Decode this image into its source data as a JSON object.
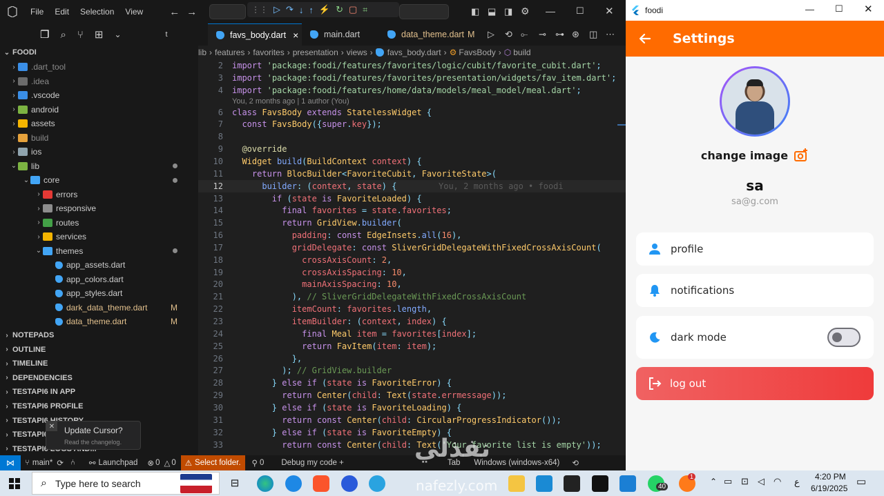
{
  "vscode": {
    "menu": [
      "File",
      "Edit",
      "Selection",
      "View"
    ],
    "sidebar_title": "FOODI",
    "tree": [
      {
        "label": "dart_tool",
        "display": ".dart_tool",
        "depth": 0,
        "expanded": false,
        "color": "#3a8ee6",
        "dim": true
      },
      {
        "label": "idea",
        "display": ".idea",
        "depth": 0,
        "expanded": false,
        "color": "#6b6b6b",
        "dim": true
      },
      {
        "label": "vscode",
        "display": ".vscode",
        "depth": 0,
        "expanded": false,
        "color": "#3a8ee6",
        "dim": false
      },
      {
        "label": "android",
        "display": "android",
        "depth": 0,
        "expanded": false,
        "color": "#7cb342",
        "dim": false
      },
      {
        "label": "assets",
        "display": "assets",
        "depth": 0,
        "expanded": false,
        "color": "#f4b400",
        "dim": false
      },
      {
        "label": "build",
        "display": "build",
        "depth": 0,
        "expanded": false,
        "color": "#e6a23c",
        "dim": true
      },
      {
        "label": "ios",
        "display": "ios",
        "depth": 0,
        "expanded": false,
        "color": "#90a4ae",
        "dim": false
      },
      {
        "label": "lib",
        "display": "lib",
        "depth": 0,
        "expanded": true,
        "color": "#7cb342",
        "dim": false,
        "dot": true
      },
      {
        "label": "core",
        "display": "core",
        "depth": 1,
        "expanded": true,
        "color": "#42a5f5",
        "dim": false,
        "dot": true
      },
      {
        "label": "errors",
        "display": "errors",
        "depth": 2,
        "expanded": false,
        "color": "#e53935",
        "dim": false
      },
      {
        "label": "responsive",
        "display": "responsive",
        "depth": 2,
        "expanded": false,
        "color": "#8d8d8d",
        "dim": false
      },
      {
        "label": "routes",
        "display": "routes",
        "depth": 2,
        "expanded": false,
        "color": "#43a047",
        "dim": false
      },
      {
        "label": "services",
        "display": "services",
        "depth": 2,
        "expanded": false,
        "color": "#f4b400",
        "dim": false
      },
      {
        "label": "themes",
        "display": "themes",
        "depth": 2,
        "expanded": true,
        "color": "#42a5f5",
        "dim": false,
        "dot": true
      },
      {
        "label": "app_assets",
        "display": "app_assets.dart",
        "depth": 3,
        "file": true,
        "color": "#42a5f5"
      },
      {
        "label": "app_colors",
        "display": "app_colors.dart",
        "depth": 3,
        "file": true,
        "color": "#42a5f5"
      },
      {
        "label": "app_styles",
        "display": "app_styles.dart",
        "depth": 3,
        "file": true,
        "color": "#42a5f5"
      },
      {
        "label": "dark_data_theme",
        "display": "dark_data_theme.dart",
        "depth": 3,
        "file": true,
        "color": "#42a5f5",
        "modified": "M"
      },
      {
        "label": "data_theme",
        "display": "data_theme.dart",
        "depth": 3,
        "file": true,
        "color": "#42a5f5",
        "modified": "M"
      }
    ],
    "panels": [
      "NOTEPADS",
      "OUTLINE",
      "TIMELINE",
      "DEPENDENCIES",
      "TESTAPI6 IN APP",
      "TESTAPI6 PROFILE",
      "TESTAPI6 HISTORY",
      "TESTAPI6",
      "TESTAPI6 LOGS AND..."
    ],
    "tabs": [
      {
        "label": "favs_body.dart",
        "active": true,
        "close": "×"
      },
      {
        "label": "main.dart",
        "active": false
      },
      {
        "label": "data_theme.dart",
        "active": false,
        "badge": "M"
      }
    ],
    "breadcrumb": [
      "lib",
      "features",
      "favorites",
      "presentation",
      "views",
      "favs_body.dart",
      "FavsBody",
      "build"
    ],
    "blame_header": "You, 2 months ago | 1 author (You)",
    "inline_blame": "You, 2 months ago • foodi",
    "code_lines": [
      {
        "n": "2",
        "t": "import 'package:foodi/features/favorites/logic/cubit/favorite_cubit.dart';"
      },
      {
        "n": "3",
        "t": "import 'package:foodi/features/favorites/presentation/widgets/fav_item.dart';"
      },
      {
        "n": "4",
        "t": "import 'package:foodi/features/home/data/models/meal_model/meal.dart';"
      },
      {
        "n": "6",
        "t": "class FavsBody extends StatelessWidget {"
      },
      {
        "n": "7",
        "t": "  const FavsBody({super.key});"
      },
      {
        "n": "8",
        "t": ""
      },
      {
        "n": "9",
        "t": "  @override"
      },
      {
        "n": "10",
        "t": "  Widget build(BuildContext context) {"
      },
      {
        "n": "11",
        "t": "    return BlocBuilder<FavoriteCubit, FavoriteState>("
      },
      {
        "n": "12",
        "t": "      builder: (context, state) {"
      },
      {
        "n": "13",
        "t": "        if (state is FavoriteLoaded) {"
      },
      {
        "n": "14",
        "t": "          final favorites = state.favorites;"
      },
      {
        "n": "15",
        "t": "          return GridView.builder("
      },
      {
        "n": "16",
        "t": "            padding: const EdgeInsets.all(16),"
      },
      {
        "n": "17",
        "t": "            gridDelegate: const SliverGridDelegateWithFixedCrossAxisCount("
      },
      {
        "n": "18",
        "t": "              crossAxisCount: 2,"
      },
      {
        "n": "19",
        "t": "              crossAxisSpacing: 10,"
      },
      {
        "n": "20",
        "t": "              mainAxisSpacing: 10,"
      },
      {
        "n": "21",
        "t": "            ), // SliverGridDelegateWithFixedCrossAxisCount"
      },
      {
        "n": "22",
        "t": "            itemCount: favorites.length,"
      },
      {
        "n": "23",
        "t": "            itemBuilder: (context, index) {"
      },
      {
        "n": "24",
        "t": "              final Meal item = favorites[index];"
      },
      {
        "n": "25",
        "t": "              return FavItem(item: item);"
      },
      {
        "n": "26",
        "t": "            },"
      },
      {
        "n": "27",
        "t": "          ); // GridView.builder"
      },
      {
        "n": "28",
        "t": "        } else if (state is FavoriteError) {"
      },
      {
        "n": "29",
        "t": "          return Center(child: Text(state.errmessage));"
      },
      {
        "n": "30",
        "t": "        } else if (state is FavoriteLoading) {"
      },
      {
        "n": "31",
        "t": "          return const Center(child: CircularProgressIndicator());"
      },
      {
        "n": "32",
        "t": "        } else if (state is FavoriteEmpty) {"
      },
      {
        "n": "33",
        "t": "          return const Center(child: Text('Your favorite list is empty'));"
      }
    ],
    "status": {
      "branch": "main*",
      "launchpad": "Launchpad",
      "errors": "0",
      "warnings": "0",
      "select_folder": "Select folder.",
      "ports": "0",
      "debug": "Debug my code +",
      "tab": "Tab",
      "platform": "Windows (windows-x64)"
    },
    "toast": {
      "title": "Update Cursor?",
      "subtitle": "Read the changelog."
    }
  },
  "foodi": {
    "window_title": "foodi",
    "appbar_title": "Settings",
    "change_image": "change image",
    "name": "sa",
    "email": "sa@g.com",
    "items": [
      {
        "label": "profile",
        "icon": "person-icon"
      },
      {
        "label": "notifications",
        "icon": "bell-icon"
      },
      {
        "label": "dark mode",
        "icon": "moon-icon",
        "toggle": false
      }
    ],
    "logout": "log out",
    "colors": {
      "primary": "#ff6b00",
      "accent": "#2196f3",
      "logout": "#ef3b3b"
    }
  },
  "taskbar": {
    "search_placeholder": "Type here to search",
    "time": "4:20 PM",
    "date": "6/19/2025",
    "lang": "ع",
    "whatsapp_badge": "40",
    "notif_badge": "1"
  },
  "watermark": {
    "text": "نفذلي",
    "sub": "nafezly.com"
  }
}
